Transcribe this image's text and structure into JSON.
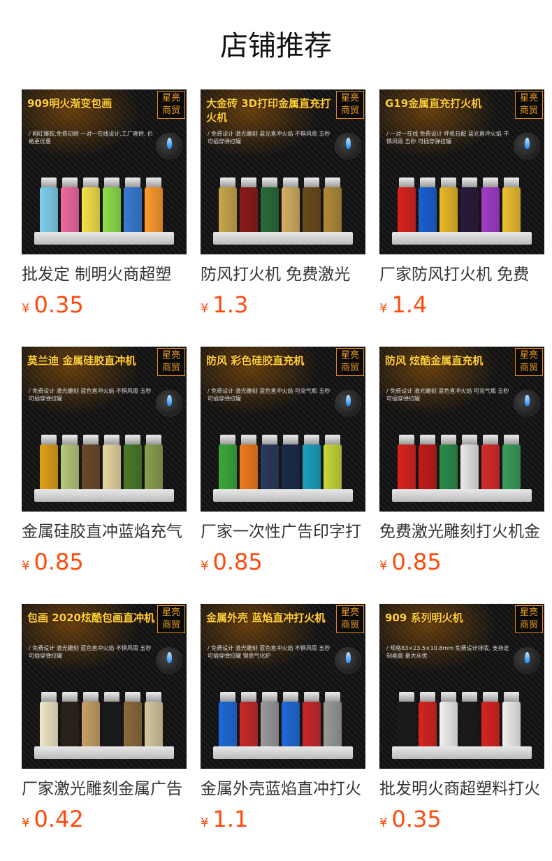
{
  "page": {
    "title": "店铺推荐"
  },
  "colors": {
    "price": "#ff4a0c",
    "badge": "#f4a224",
    "headline": "#ffd23a"
  },
  "products": [
    {
      "name": "批发定 制明火商超塑",
      "currency": "¥",
      "price": "0.35",
      "image": {
        "badge": "星亮商贸",
        "headline": "909明火渐变包画",
        "subline": "/ 网红爆款,免费印刷 一对一在线设计,工厂直供, 价格更优惠",
        "colors": [
          "#7fd0f0",
          "#f06aa0",
          "#f6e24a",
          "#8ee04a",
          "#3a7bd5",
          "#ff9a2a"
        ]
      }
    },
    {
      "name": "防风打火机 免费激光",
      "currency": "¥",
      "price": "1.3",
      "image": {
        "badge": "星亮商贸",
        "headline": "大金砖 3D打印金属直充打火机",
        "subline": "/ 免费设计 激光雕刻 蓝光直冲火焰 不惧风雨 五秒 可插穿弹拉罐",
        "colors": [
          "#c9a64a",
          "#8a1a1a",
          "#2a6a3a",
          "#d4b060",
          "#6a4a1a",
          "#b08a3a"
        ]
      }
    },
    {
      "name": "厂家防风打火机 免费",
      "currency": "¥",
      "price": "1.4",
      "image": {
        "badge": "星亮商贸",
        "headline": "G19金属直充打火机",
        "subline": "/ 一对一在线 免费设计 坏机包配 蓝光直冲火焰 不惧风雨 五秒 可插穿弹拉罐",
        "colors": [
          "#d8231f",
          "#1c5fd0",
          "#e8b826",
          "#2a1a3a",
          "#a23cc8",
          "#f0c030"
        ]
      }
    },
    {
      "name": "金属硅胶直冲蓝焰充气",
      "currency": "¥",
      "price": "0.85",
      "image": {
        "badge": "星亮商贸",
        "headline": "莫兰迪 金属硅胶直冲机",
        "subline": "/ 免费设计 激光雕刻 蓝色直冲火焰 不惧风雨 五秒 可插穿弹拉罐",
        "colors": [
          "#e0a01a",
          "#b8c87a",
          "#6a4a2a",
          "#e8d8a0",
          "#4a7a2a",
          "#8aa050"
        ]
      }
    },
    {
      "name": "厂家一次性广告印字打",
      "currency": "¥",
      "price": "0.85",
      "image": {
        "badge": "星亮商贸",
        "headline": "防风 彩色硅胶直充机",
        "subline": "/ 免费设计 激光雕刻 蓝色直冲火焰 可充气瓶 五秒 可插穿弹拉罐",
        "colors": [
          "#3aa83a",
          "#f07a1a",
          "#2a3a5a",
          "#1a2a4a",
          "#1aa0c0",
          "#c8d83a"
        ]
      }
    },
    {
      "name": "免费激光雕刻打火机金",
      "currency": "¥",
      "price": "0.85",
      "image": {
        "badge": "星亮商贸",
        "headline": "防风 炫酷金属直充机",
        "subline": "/ 免费设计 激光雕刻 蓝色直冲火焰 可充气瓶 五秒 可插穿弹拉罐",
        "colors": [
          "#d8231f",
          "#c01a1a",
          "#2a8a4a",
          "#e8e8e8",
          "#d82a2a",
          "#3a9a5a"
        ]
      }
    },
    {
      "name": "厂家激光雕刻金属广告",
      "currency": "¥",
      "price": "0.42",
      "image": {
        "badge": "星亮商贸",
        "headline": "包画 2020炫酷包画直冲机",
        "subline": "/ 免费设计 激光雕刻 蓝色直冲火焰 不惧风雨 五秒 可插穿弹拉罐",
        "colors": [
          "#f0e6c8",
          "#2a2218",
          "#c8a064",
          "#1a1a1a",
          "#8a6a3a",
          "#d8c8a0"
        ]
      }
    },
    {
      "name": "金属外壳蓝焰直冲打火",
      "currency": "¥",
      "price": "1.1",
      "image": {
        "badge": "星亮商贸",
        "headline": "金属外壳 蓝焰直冲打火机",
        "subline": "/ 免费设计 激光雕刻 蓝色直冲火焰 不惧风雨 五秒 可插穿弹拉罐 铜质气化炉",
        "colors": [
          "#1e6ad8",
          "#c8282a",
          "#9a9a9a",
          "#1e6ad8",
          "#c8282a",
          "#9a9a9a"
        ]
      }
    },
    {
      "name": "批发明火商超塑料打火",
      "currency": "¥",
      "price": "0.35",
      "image": {
        "badge": "星亮商贸",
        "headline": "909 系列明火机",
        "subline": "/ 规格83×23.5×10.8mm 免费设计排版, 支持定制画面 量大从优",
        "colors": [
          "#1a1a1a",
          "#d8231f",
          "#f0f0f0",
          "#1a1a1a",
          "#d8231f",
          "#f0f0f0"
        ]
      }
    }
  ]
}
